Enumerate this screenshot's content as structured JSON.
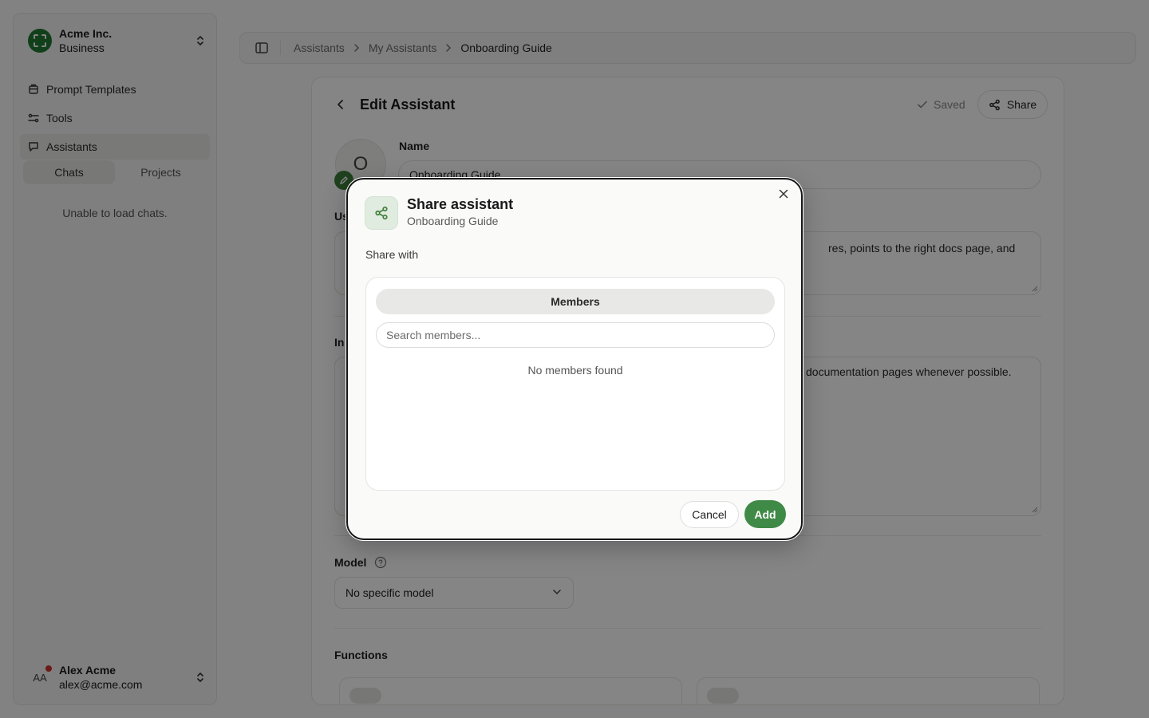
{
  "org": {
    "name": "Acme Inc.",
    "plan": "Business"
  },
  "sidebar": {
    "items": [
      {
        "label": "Prompt Templates",
        "icon": "template-icon"
      },
      {
        "label": "Tools",
        "icon": "tools-icon"
      },
      {
        "label": "Assistants",
        "icon": "assistant-icon",
        "active": true
      }
    ],
    "tabs": [
      {
        "label": "Chats",
        "active": true
      },
      {
        "label": "Projects"
      }
    ],
    "empty_state": "Unable to load chats."
  },
  "user": {
    "initials": "AA",
    "name": "Alex Acme",
    "email": "alex@acme.com"
  },
  "breadcrumb": [
    "Assistants",
    "My Assistants",
    "Onboarding Guide"
  ],
  "editor": {
    "title": "Edit Assistant",
    "saved_label": "Saved",
    "share_label": "Share",
    "avatar_letter": "O",
    "name_label": "Name",
    "name_value": "Onboarding Guide",
    "usage_label_partial": "Us",
    "usage_visible_text": "res, points to the right docs page, and",
    "instructions_label_partial": "In",
    "instructions_visible_text": "documentation pages whenever possible.",
    "model_label": "Model",
    "model_value": "No specific model",
    "functions_label": "Functions"
  },
  "modal": {
    "title": "Share assistant",
    "subtitle": "Onboarding Guide",
    "share_with_label": "Share with",
    "tab_label": "Members",
    "search_placeholder": "Search members...",
    "empty_text": "No members found",
    "cancel_label": "Cancel",
    "add_label": "Add"
  },
  "colors": {
    "accent": "#3f8a46",
    "brand": "#1f7a33",
    "notification_dot": "#d0302c"
  }
}
